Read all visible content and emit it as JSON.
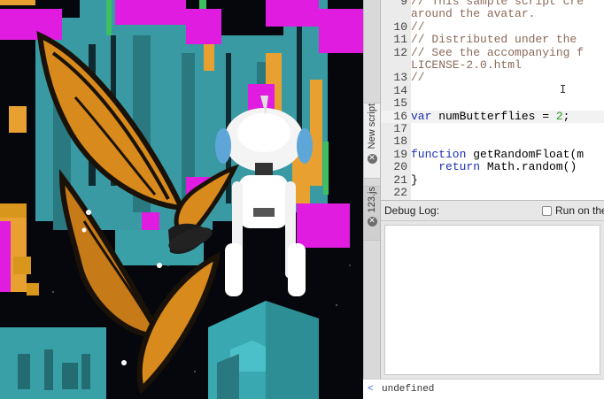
{
  "tabs": [
    {
      "label": "New script",
      "close_icon": "close-icon"
    },
    {
      "label": "123.js",
      "close_icon": "close-icon"
    }
  ],
  "editor": {
    "lines": [
      {
        "num": "9",
        "text": "// This sample script cre",
        "kind": "comment"
      },
      {
        "num": "",
        "text": "around the avatar.",
        "kind": "comment"
      },
      {
        "num": "10",
        "text": "//",
        "kind": "comment"
      },
      {
        "num": "11",
        "text": "// Distributed under the",
        "kind": "comment"
      },
      {
        "num": "12",
        "text": "// See the accompanying f",
        "kind": "comment"
      },
      {
        "num": "",
        "text": "LICENSE-2.0.html",
        "kind": "comment"
      },
      {
        "num": "13",
        "text": "//",
        "kind": "comment"
      },
      {
        "num": "14",
        "text": "",
        "kind": "code"
      },
      {
        "num": "15",
        "text": "",
        "kind": "code"
      },
      {
        "num": "16",
        "text": "var numButterflies = 2;",
        "kind": "code"
      },
      {
        "num": "17",
        "text": "",
        "kind": "code"
      },
      {
        "num": "18",
        "text": "",
        "kind": "code"
      },
      {
        "num": "19",
        "text": "function getRandomFloat(m",
        "kind": "code"
      },
      {
        "num": "20",
        "text": "    return Math.random()",
        "kind": "code"
      },
      {
        "num": "21",
        "text": "}",
        "kind": "code"
      },
      {
        "num": "22",
        "text": "",
        "kind": "code"
      }
    ],
    "current_line": "16"
  },
  "debug": {
    "title": "Debug Log:",
    "run_label": "Run on the",
    "run_checked": false
  },
  "console": {
    "prompt": "<",
    "value": "undefined"
  },
  "colors": {
    "magenta": "#e01ce0",
    "teal": "#3aa0a8",
    "orange": "#e8a030",
    "butterfly_orange": "#d98a1c"
  }
}
